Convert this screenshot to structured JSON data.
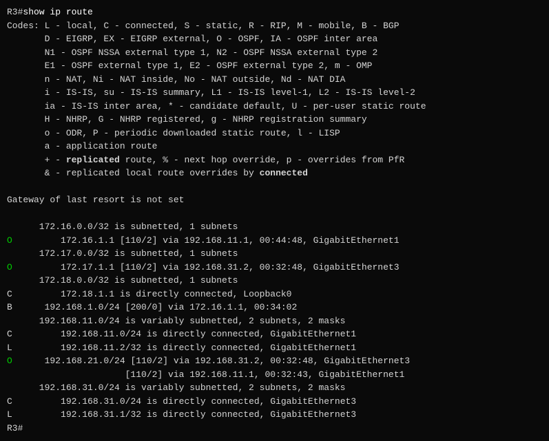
{
  "terminal": {
    "prompt": "R3#",
    "command": "show ip route",
    "lines": [
      {
        "text": "Codes: L - local, C - connected, S - static, R - RIP, M - mobile, B - BGP"
      },
      {
        "text": "       D - EIGRP, EX - EIGRP external, O - OSPF, IA - OSPF inter area"
      },
      {
        "text": "       N1 - OSPF NSSA external type 1, N2 - OSPF NSSA external type 2"
      },
      {
        "text": "       E1 - OSPF external type 1, E2 - OSPF external type 2, m - OMP"
      },
      {
        "text": "       n - NAT, Ni - NAT inside, No - NAT outside, Nd - NAT DIA"
      },
      {
        "text": "       i - IS-IS, su - IS-IS summary, L1 - IS-IS level-1, L2 - IS-IS level-2"
      },
      {
        "text": "       ia - IS-IS inter area, * - candidate default, U - per-user static route"
      },
      {
        "text": "       H - NHRP, G - NHRP registered, g - NHRP registration summary"
      },
      {
        "text": "       o - ODR, P - periodic downloaded static route, l - LISP"
      },
      {
        "text": "       a - application route"
      },
      {
        "text": "       + - replicated route, % - next hop override, p - overrides from PfR"
      },
      {
        "text": "       & - replicated local route overrides by connected"
      },
      {
        "text": ""
      },
      {
        "text": "Gateway of last resort is not set"
      },
      {
        "text": ""
      },
      {
        "text": "      172.16.0.0/32 is subnetted, 1 subnets"
      },
      {
        "type": "O",
        "prefix": "O",
        "text": "         172.16.1.1 [110/2] via 192.168.11.1, 00:44:48, GigabitEthernet1"
      },
      {
        "text": "      172.17.0.0/32 is subnetted, 1 subnets"
      },
      {
        "type": "O",
        "prefix": "O",
        "text": "         172.17.1.1 [110/2] via 192.168.31.2, 00:32:48, GigabitEthernet3"
      },
      {
        "text": "      172.18.0.0/32 is subnetted, 1 subnets"
      },
      {
        "type": "C",
        "prefix": "C",
        "text": "         172.18.1.1 is directly connected, Loopback0"
      },
      {
        "type": "B",
        "prefix": "B",
        "text": "      192.168.1.0/24 [200/0] via 172.16.1.1, 00:34:02"
      },
      {
        "text": "      192.168.11.0/24 is variably subnetted, 2 subnets, 2 masks"
      },
      {
        "type": "C",
        "prefix": "C",
        "text": "         192.168.11.0/24 is directly connected, GigabitEthernet1"
      },
      {
        "type": "L",
        "prefix": "L",
        "text": "         192.168.11.2/32 is directly connected, GigabitEthernet1"
      },
      {
        "type": "O",
        "prefix": "O",
        "text": "      192.168.21.0/24 [110/2] via 192.168.31.2, 00:32:48, GigabitEthernet3"
      },
      {
        "text": "                      [110/2] via 192.168.11.1, 00:32:43, GigabitEthernet1"
      },
      {
        "text": "      192.168.31.0/24 is variably subnetted, 2 subnets, 2 masks"
      },
      {
        "type": "C",
        "prefix": "C",
        "text": "         192.168.31.0/24 is directly connected, GigabitEthernet3"
      },
      {
        "type": "L",
        "prefix": "L",
        "text": "         192.168.31.1/32 is directly connected, GigabitEthernet3"
      }
    ],
    "end_prompt": "R3#"
  }
}
